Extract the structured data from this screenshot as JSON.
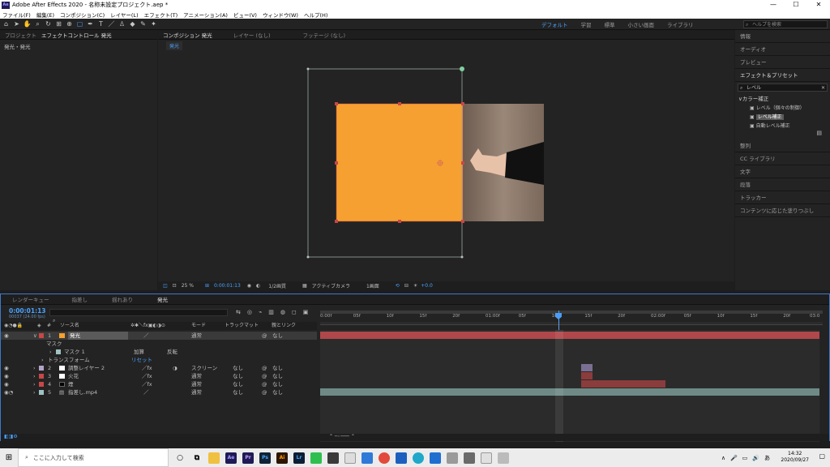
{
  "window": {
    "title": "Adobe After Effects 2020 - 名称未設定プロジェクト.aep *",
    "app_logo": "Ae",
    "minimize": "—",
    "maximize": "☐",
    "close": "✕"
  },
  "menu": [
    "ファイル(F)",
    "編集(E)",
    "コンポジション(C)",
    "レイヤー(L)",
    "エフェクト(T)",
    "アニメーション(A)",
    "ビュー(V)",
    "ウィンドウ(W)",
    "ヘルプ(H)"
  ],
  "workspaces": [
    "デフォルト",
    "学習",
    "標準",
    "小さい画面",
    "ライブラリ"
  ],
  "help_search": {
    "placeholder": "ヘルプを検索"
  },
  "left_panel": {
    "tabs": [
      "プロジェクト",
      "エフェクトコントロール 発光"
    ],
    "subtitle": "発光・発光"
  },
  "comp_panel": {
    "tabs": [
      "コンポジション 発光",
      "レイヤー (なし)",
      "フッテージ (なし)"
    ],
    "breadcrumb": "発光",
    "footer": {
      "zoom": "25 %",
      "timecode": "0:00:01:13",
      "resolution": "1/2画質",
      "camera": "アクティブカメラ",
      "view": "1画面",
      "exposure": "+0.0"
    }
  },
  "right_panel": {
    "items": [
      "情報",
      "オーディオ",
      "プレビュー",
      "エフェクト＆プリセット"
    ],
    "search_value": "レベル",
    "tree_group": "カラー補正",
    "tree_items": [
      "レベル（個々の制御）",
      "レベル補正",
      "自動レベル補正"
    ],
    "sections": [
      "整列",
      "CC ライブラリ",
      "文字",
      "段落",
      "トラッカー",
      "コンテンツに応じた塗りつぶし"
    ]
  },
  "timeline": {
    "tabs": [
      "レンダーキュー",
      "指差し",
      "揺れあり",
      "発光"
    ],
    "timecode": "0:00:01:13",
    "frames": "00037 (24.00 fps)",
    "columns": {
      "source": "ソース名",
      "mode": "モード",
      "trkmat": "トラックマット",
      "parent": "親とリンク"
    },
    "ruler": [
      "0:00f",
      "05f",
      "10f",
      "15f",
      "20f",
      "01:00f",
      "05f",
      "10f",
      "15f",
      "20f",
      "02:00f",
      "05f",
      "10f",
      "15f",
      "20f",
      "03:0"
    ],
    "layers": [
      {
        "num": "1",
        "name": "発光",
        "mode": "通常",
        "trk": "",
        "parent": "なし",
        "color": "#c84747"
      },
      {
        "num": "2",
        "name": "調整レイヤー 2",
        "mode": "スクリーン",
        "trk": "なし",
        "parent": "なし",
        "color": "#b3a3c9"
      },
      {
        "num": "3",
        "name": "火花",
        "mode": "通常",
        "trk": "なし",
        "parent": "なし",
        "color": "#c84747"
      },
      {
        "num": "4",
        "name": "煙",
        "mode": "通常",
        "trk": "なし",
        "parent": "なし",
        "color": "#c84747"
      },
      {
        "num": "5",
        "name": "指差し.mp4",
        "mode": "通常",
        "trk": "なし",
        "parent": "なし",
        "color": "#9fc2c2"
      }
    ],
    "mask_group": "マスク",
    "mask1": "マスク 1",
    "mask_mode": "加算",
    "mask_invert": "反転",
    "transform": "トランスフォーム",
    "reset": "リセット"
  },
  "taskbar": {
    "search_placeholder": "ここに入力して検索",
    "time": "14:32",
    "date": "2020/09/27",
    "ime": "あ",
    "apps": [
      "Ae",
      "Pr",
      "Ps",
      "Ai",
      "Lr"
    ]
  }
}
